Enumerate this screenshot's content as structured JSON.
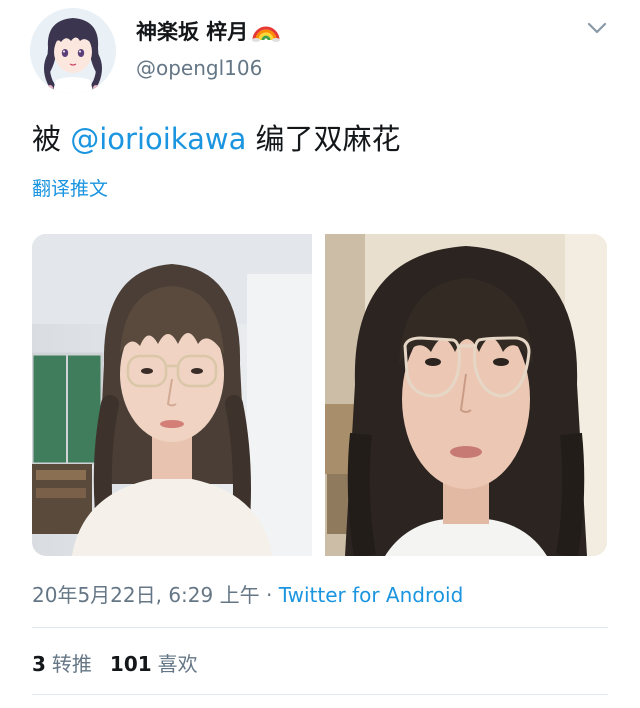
{
  "author": {
    "display_name": "神楽坂 梓月",
    "handle": "@opengl106",
    "name_emoji": "rainbow-icon"
  },
  "tweet": {
    "text_before": "被 ",
    "mention": "@iorioikawa",
    "text_after": " 编了双麻花",
    "translate_label": "翻译推文"
  },
  "media": {
    "count": 2,
    "items": [
      "photo-1",
      "photo-2"
    ]
  },
  "meta": {
    "timestamp": "20年5月22日, 6:29 上午",
    "separator": " · ",
    "source": "Twitter for Android"
  },
  "stats": {
    "retweets_count": "3",
    "retweets_label": "转推",
    "likes_count": "101",
    "likes_label": "喜欢"
  },
  "colors": {
    "link": "#1b95e0",
    "secondary_text": "#657786",
    "primary_text": "#14171a",
    "divider": "#e1e8ed"
  }
}
